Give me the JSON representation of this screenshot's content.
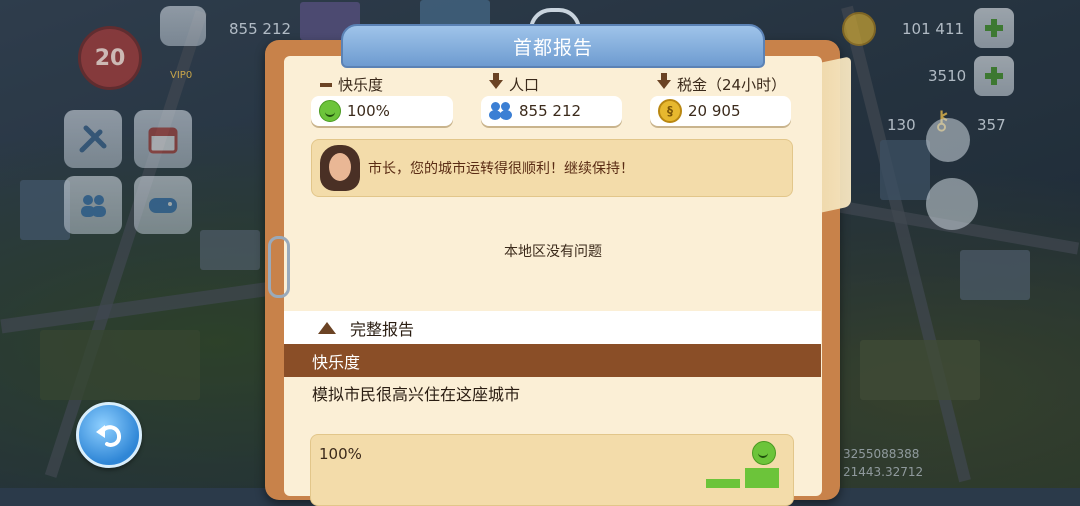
{
  "hud": {
    "population_top": "855 212",
    "level": "20",
    "vip": "VIP0",
    "coins_top": "101 411",
    "bucks_top": "3510",
    "keys_left": "130",
    "keys_right": "357"
  },
  "panel": {
    "title": "首都报告",
    "happiness": {
      "label": "快乐度",
      "value": "100%"
    },
    "population": {
      "label": "人口",
      "value": "855 212"
    },
    "taxes": {
      "label": "税金（24小时）",
      "value": "20 905"
    },
    "mayor_message": "市长，您的城市运转得很顺利！继续保持！",
    "no_issues": "本地区没有问题",
    "full_report_label": "完整报告",
    "section_title": "快乐度",
    "section_description": "模拟市民很高兴住在这座城市",
    "graph_max_label": "100%",
    "graph_levels": [
      0.2,
      0.45
    ]
  },
  "overlay_numbers": [
    "3255088388",
    "21443.32712"
  ],
  "colors": {
    "accent_green": "#6cc43a",
    "section_brown": "#8a4e27",
    "title_blue": "#6e9bd0"
  }
}
